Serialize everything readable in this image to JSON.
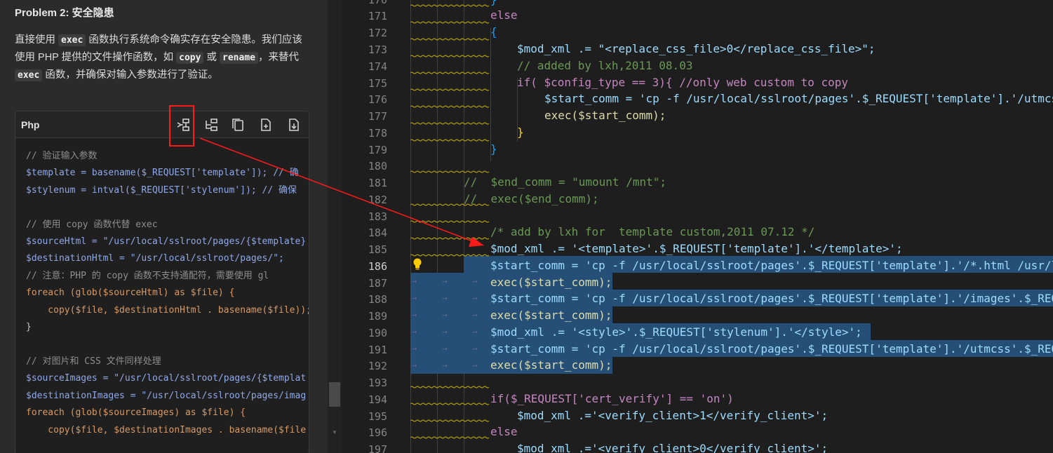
{
  "chat": {
    "heading": "Problem 2: 安全隐患",
    "para": {
      "t1": "直接使用 ",
      "c1": "exec",
      "t2": " 函数执行系统命令确实存在安全隐患。我们应该使用 PHP 提供的文件操作函数，如 ",
      "c2": "copy",
      "t3": " 或 ",
      "c3": "rename",
      "t4": "，来替代 ",
      "c4": "exec",
      "t5": " 函数，并确保对输入参数进行了验证。"
    },
    "code_block": {
      "language": "Php",
      "toolbar": [
        "insert-at-cursor-icon",
        "insert-into-new-file-icon",
        "copy-icon",
        "new-file-icon",
        "save-icon"
      ],
      "lines": [
        "// 验证输入参数",
        "$template = basename($_REQUEST['template']); // 确",
        "$stylenum = intval($_REQUEST['stylenum']); // 确保",
        "",
        "// 使用 copy 函数代替 exec",
        "$sourceHtml = \"/usr/local/sslroot/pages/{$template}",
        "$destinationHtml = \"/usr/local/sslroot/pages/\";",
        "// 注意：PHP 的 copy 函数不支持通配符，需要使用 gl",
        "foreach (glob($sourceHtml) as $file) {",
        "    copy($file, $destinationHtml . basename($file));",
        "}",
        "",
        "// 对图片和 CSS 文件同样处理",
        "$sourceImages = \"/usr/local/sslroot/pages/{$templat",
        "$destinationImages = \"/usr/local/sslroot/pages/imag",
        "foreach (glob($sourceImages) as $file) {",
        "    copy($file, $destinationImages . basename($file"
      ]
    }
  },
  "editor": {
    "current_line": 186,
    "lines": [
      {
        "n": "170",
        "text": "}"
      },
      {
        "n": "171",
        "text": "else"
      },
      {
        "n": "172",
        "text": "{"
      },
      {
        "n": "173",
        "text": "$mod_xml .= \"<replace_css_file>0</replace_css_file>\";"
      },
      {
        "n": "174",
        "text": "// added by lxh,2011 08.03"
      },
      {
        "n": "175",
        "text": "if( $config_type == 3){ //only web custom to copy"
      },
      {
        "n": "176",
        "text": "$start_comm = 'cp -f /usr/local/sslroot/pages'.$_REQUEST['template'].'/utmcss'"
      },
      {
        "n": "177",
        "text": "exec($start_comm);"
      },
      {
        "n": "178",
        "text": "}"
      },
      {
        "n": "179",
        "text": "}"
      },
      {
        "n": "180",
        "text": ""
      },
      {
        "n": "181",
        "text": "//  $end_comm = \"umount /mnt\";"
      },
      {
        "n": "182",
        "text": "//  exec($end_comm);"
      },
      {
        "n": "183",
        "text": ""
      },
      {
        "n": "184",
        "text": "/* add by lxh for  template custom,2011 07.12 */"
      },
      {
        "n": "185",
        "text": "$mod_xml .= '<template>'.$_REQUEST['template'].'</template>';"
      },
      {
        "n": "186",
        "text": "$start_comm = 'cp -f /usr/local/sslroot/pages'.$_REQUEST['template'].'/*.html /usr/l"
      },
      {
        "n": "187",
        "text": "exec($start_comm);"
      },
      {
        "n": "188",
        "text": "$start_comm = 'cp -f /usr/local/sslroot/pages'.$_REQUEST['template'].'/images'.$_REQ"
      },
      {
        "n": "189",
        "text": "exec($start_comm);"
      },
      {
        "n": "190",
        "text": "$mod_xml .= '<style>'.$_REQUEST['stylenum'].'</style>';"
      },
      {
        "n": "191",
        "text": "$start_comm = 'cp -f /usr/local/sslroot/pages'.$_REQUEST['template'].'/utmcss'.$_REQ"
      },
      {
        "n": "192",
        "text": "exec($start_comm);"
      },
      {
        "n": "193",
        "text": ""
      },
      {
        "n": "194",
        "text": "if($_REQUEST['cert_verify'] == 'on')"
      },
      {
        "n": "195",
        "text": "$mod_xml .='<verify_client>1</verify_client>';"
      },
      {
        "n": "196",
        "text": "else"
      },
      {
        "n": "197",
        "text": "$mod_xml .='<verify_client>0</verify_client>';"
      }
    ]
  },
  "colors": {
    "highlight_box": "#ff1a1a",
    "arrow": "#ff1a1a",
    "selection": "#264f78"
  }
}
